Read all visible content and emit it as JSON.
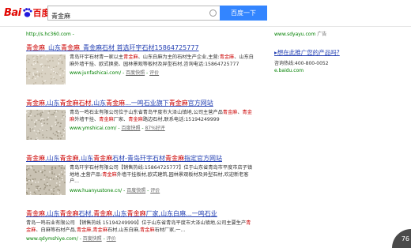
{
  "header": {
    "logo_left": "Bai",
    "logo_right": "百度",
    "query": "青金麻",
    "search_button": "百度一下"
  },
  "first_url": "http://s.hc360.com - ",
  "results": [
    {
      "title_parts": [
        {
          "t": "青金麻",
          "hl": true
        },
        {
          "t": "_山东",
          "hl": false
        },
        {
          "t": "青金麻",
          "hl": true
        },
        {
          "t": "_青金麻石材",
          "hl": false
        },
        {
          "t": " 首选玕宇石材15864725777",
          "hl": false
        }
      ],
      "text_parts": [
        {
          "t": "青岛玕宇石材青一家以主",
          "hl": false
        },
        {
          "t": "青金麻",
          "hl": true
        },
        {
          "t": "、山东白麻为主的石材生产企业,主营:",
          "hl": false
        },
        {
          "t": "青金麻",
          "hl": true
        },
        {
          "t": "、山东白麻外墙干挂、欧式换瓷、园林景观等板材及异型石材,咨询电话:15864725777",
          "hl": false
        }
      ],
      "url": "www.junfashicai.com/",
      "snapshot": "百度快照",
      "rating": "",
      "evaluate": "评价"
    },
    {
      "title_parts": [
        {
          "t": "青金麻",
          "hl": true
        },
        {
          "t": ",山东",
          "hl": false
        },
        {
          "t": "青金麻石材",
          "hl": true
        },
        {
          "t": ",山东",
          "hl": false
        },
        {
          "t": "青金麻",
          "hl": true
        },
        {
          "t": "...一鸣石业旗下",
          "hl": false
        },
        {
          "t": "青金麻",
          "hl": true
        },
        {
          "t": "官方网站",
          "hl": false
        }
      ],
      "text_parts": [
        {
          "t": "青岛一鸣石业有限公司位于山东省青岛平度市大泽山镇地,公司主营产品",
          "hl": false
        },
        {
          "t": "青金麻",
          "hl": true
        },
        {
          "t": "、",
          "hl": false
        },
        {
          "t": "青金麻",
          "hl": true
        },
        {
          "t": "外墙干挂、",
          "hl": false
        },
        {
          "t": "青金麻",
          "hl": true
        },
        {
          "t": "厂家、",
          "hl": false
        },
        {
          "t": "青金麻",
          "hl": true
        },
        {
          "t": "路边石材,联系电话:15194249999 ",
          "hl": false
        }
      ],
      "url": "www.ymshicai.com/",
      "snapshot": "百度快照",
      "rating": "87%好评",
      "evaluate": ""
    },
    {
      "title_parts": [
        {
          "t": "青金麻",
          "hl": true
        },
        {
          "t": ",山东",
          "hl": false
        },
        {
          "t": "青金麻",
          "hl": true
        },
        {
          "t": ",山东",
          "hl": false
        },
        {
          "t": "青金麻",
          "hl": true
        },
        {
          "t": "石材-青岛玕宇石材",
          "hl": false
        },
        {
          "t": "青金麻",
          "hl": true
        },
        {
          "t": "指定官方网站",
          "hl": false
        }
      ],
      "text_parts": [
        {
          "t": "青岛玕宇石材有限公司【销售热线:15864725777】位于山东省青岛市平度市店子镇地地,主营产品:",
          "hl": false
        },
        {
          "t": "青金麻",
          "hl": true
        },
        {
          "t": "外墙干挂板材,欧式建筑,园林景观板材及异型石材,欢迎新老客户...",
          "hl": false
        }
      ],
      "url": "www.huanyustone.cn/",
      "snapshot": "百度快照",
      "rating": "",
      "evaluate": "评价"
    },
    {
      "title_parts": [
        {
          "t": "青金麻",
          "hl": true
        },
        {
          "t": ",山东",
          "hl": false
        },
        {
          "t": "青金麻",
          "hl": true
        },
        {
          "t": "石材,",
          "hl": false
        },
        {
          "t": "青金麻",
          "hl": true
        },
        {
          "t": ",山东",
          "hl": false
        },
        {
          "t": "青金麻",
          "hl": true
        },
        {
          "t": "厂家,山东白麻...一鸣石业",
          "hl": false
        }
      ],
      "text_parts": [
        {
          "t": "青岛一鸣石业有限公司 【销售热线 15194249999】位于山东省青岛平度市大泽山镇地,公司主要生产",
          "hl": false
        },
        {
          "t": "青金麻",
          "hl": true
        },
        {
          "t": "、白麻等石材产品,",
          "hl": false
        },
        {
          "t": "青金麻",
          "hl": true
        },
        {
          "t": ",",
          "hl": false
        },
        {
          "t": "青金麻",
          "hl": true
        },
        {
          "t": "石材,山东白麻,",
          "hl": false
        },
        {
          "t": "青金麻",
          "hl": true
        },
        {
          "t": "石材厂家,一...",
          "hl": false
        }
      ],
      "url": "www.qdymshiye.com/",
      "snapshot": "百度快照",
      "rating": "",
      "evaluate": "评价"
    }
  ],
  "side": {
    "url": "www.sdyayu.com ",
    "ad_label": "广告",
    "title": "想在此推广您的产品吗?",
    "phone_label": "咨询热线:",
    "phone": "400-800-0052",
    "site": "e.baidu.com"
  },
  "badge": "76"
}
